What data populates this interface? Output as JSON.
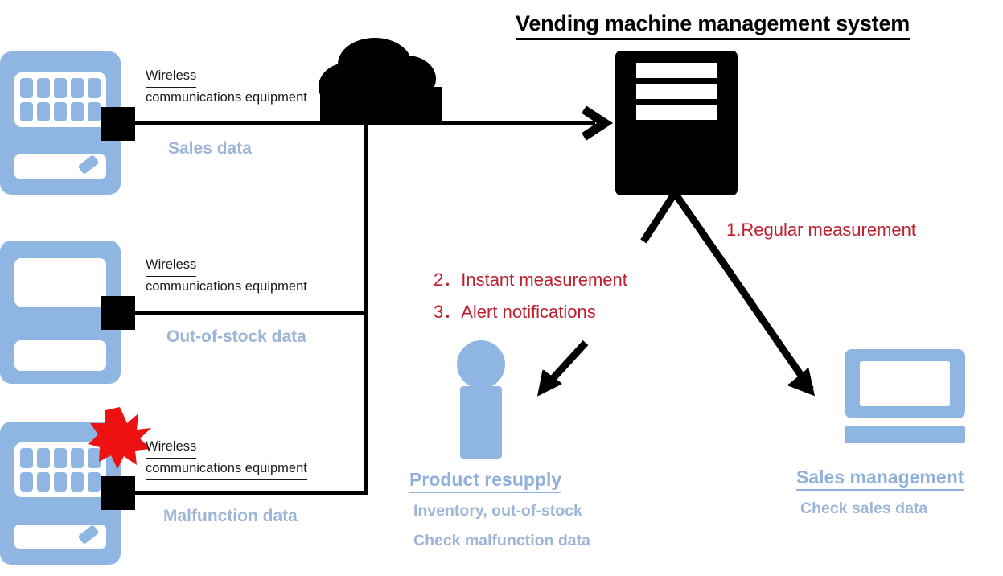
{
  "page": {
    "title": "Vending machine management system"
  },
  "colors": {
    "device_blue": "#8FB6E3",
    "label_blue": "#9DB5D6",
    "accent_red": "#BE1E2D",
    "alert_red": "#EE1111",
    "black": "#000000"
  },
  "machines": [
    {
      "id": "sales",
      "wireless_line1": "Wireless ",
      "wireless_line2": "communications equipment",
      "data_label": "Sales data",
      "alert": false,
      "panel": "grid"
    },
    {
      "id": "out-of-stock",
      "wireless_line1": "Wireless ",
      "wireless_line2": "communications equipment",
      "data_label": "Out-of-stock data",
      "alert": false,
      "panel": "empty"
    },
    {
      "id": "malfunction",
      "wireless_line1": "Wireless ",
      "wireless_line2": "communications equipment",
      "data_label": "Malfunction data",
      "alert": true,
      "panel": "grid"
    }
  ],
  "steps": {
    "step1": "1.Regular measurement",
    "step2": "2．Instant measurement",
    "step3": "3．Alert notifications"
  },
  "roles": [
    {
      "id": "product-resupply",
      "title": "Product resupply",
      "lines": [
        "Inventory, out-of-stock",
        "Check malfunction data"
      ]
    },
    {
      "id": "sales-management",
      "title": "Sales management",
      "lines": [
        "Check sales data"
      ]
    }
  ],
  "icons": {
    "cloud": "cloud-icon",
    "server": "server-icon",
    "person": "person-icon",
    "monitor": "monitor-icon",
    "alert_burst": "alert-burst-icon",
    "arrow_to_server": "arrow-right-icon",
    "arrow_to_monitor": "arrow-down-right-icon",
    "arrow_to_person": "arrow-down-left-icon"
  }
}
